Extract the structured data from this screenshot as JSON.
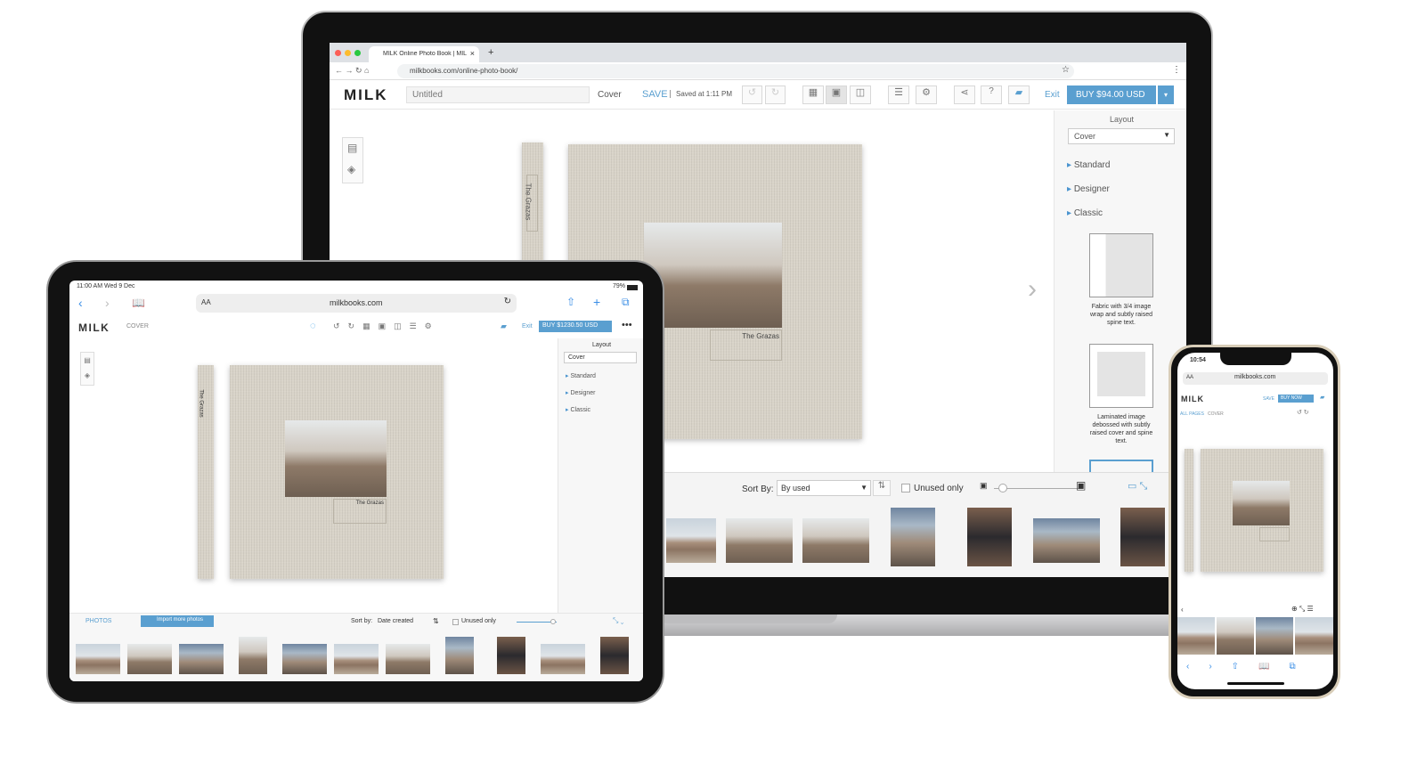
{
  "laptop": {
    "browser": {
      "tab_title": "MILK Online Photo Book | MILK",
      "url": "milkbooks.com/online-photo-book/"
    },
    "app": {
      "logo": "MILK",
      "title_input": "Untitled",
      "page_label": "Cover",
      "save": "SAVE",
      "saved_status": "Saved at 1:11 PM",
      "exit": "Exit",
      "buy": "BUY $94.00 USD",
      "accent": "#5a9fd0"
    },
    "sidebar": {
      "heading": "Layout",
      "select_value": "Cover",
      "sections": [
        "Standard",
        "Designer",
        "Classic"
      ],
      "options": [
        "Fabric with 3/4 image wrap and subtly raised spine text.",
        "Laminated image debossed with subtly raised cover and spine text."
      ]
    },
    "book": {
      "spine_text": "The Grazas",
      "cover_text": "The Grazas"
    },
    "photos_bar": {
      "sort_label": "Sort By:",
      "sort_value": "By used",
      "unused_only": "Unused only",
      "zoom": 0.1
    }
  },
  "tablet": {
    "status": {
      "time": "11:00 AM  Wed 9 Dec",
      "battery": "79%"
    },
    "url": "milkbooks.com",
    "text_size": "AA",
    "app": {
      "logo": "MILK",
      "page_label": "COVER",
      "exit": "Exit",
      "buy": "BUY $1230.50 USD"
    },
    "sidebar": {
      "heading": "Layout",
      "select_value": "Cover",
      "sections": [
        "Standard",
        "Designer",
        "Classic"
      ]
    },
    "book": {
      "spine_text": "The Grazas",
      "cover_text": "The Grazas"
    },
    "photos_bar": {
      "tab": "PHOTOS",
      "import": "Import more photos",
      "sort_label": "Sort by:",
      "sort_value": "Date created",
      "unused_only": "Unused only",
      "zoom": 0.9
    }
  },
  "phone": {
    "status": {
      "time": "10:54"
    },
    "text_size": "AA",
    "url": "milkbooks.com",
    "app": {
      "logo": "MILK",
      "save": "SAVE",
      "buy": "BUY NOW",
      "breadcrumb_all": "ALL PAGES",
      "breadcrumb_current": "COVER"
    }
  }
}
